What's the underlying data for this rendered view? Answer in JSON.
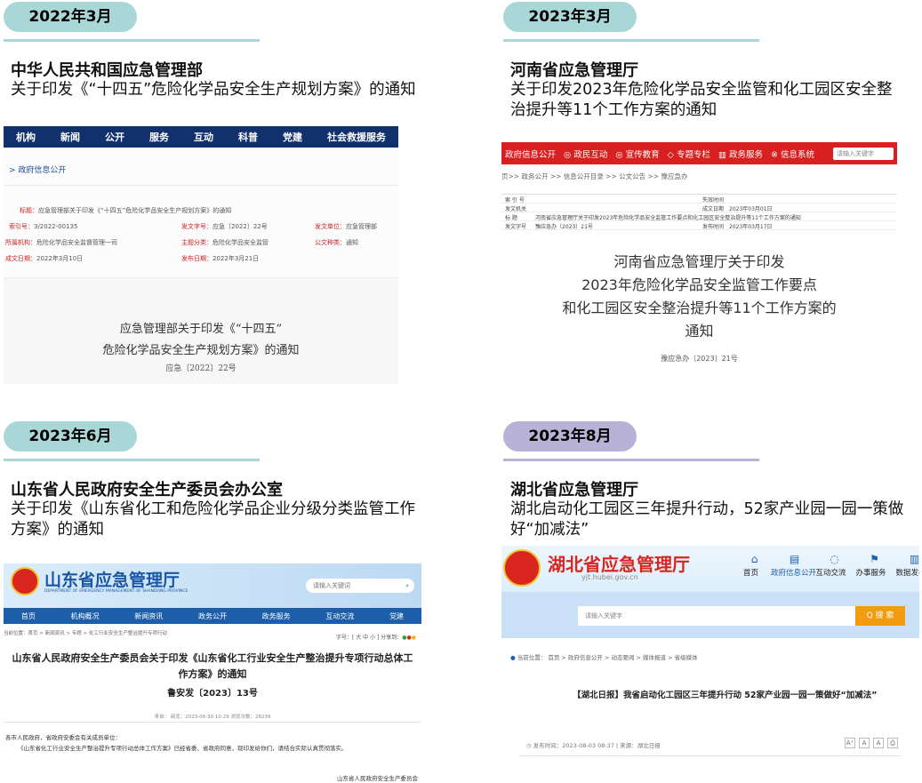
{
  "panels": [
    {
      "date": "2022年3月",
      "org": "中华人民共和国应急管理部",
      "title": "关于印发《“十四五”危险化学品安全生产规划方案》的通知"
    },
    {
      "date": "2023年3月",
      "org": "河南省应急管理厅",
      "title": "关于印发2023年危险化学品安全监管和化工园区安全整治提升等11个工作方案的通知"
    },
    {
      "date": "2023年6月",
      "org": "山东省人民政府安全生产委员会办公室",
      "title": "关于印发《山东省化工和危险化学品企业分级分类监管工作方案》的通知"
    },
    {
      "date": "2023年8月",
      "org": "湖北省应急管理厅",
      "title": "湖北启动化工园区三年提升行动，52家产业园一园一策做好“加减法”"
    }
  ],
  "colors": {
    "pill_teal": "#a9d6d7",
    "pill_purple": "#b8b2d6"
  },
  "shot1": {
    "nav": [
      "机构",
      "新闻",
      "公开",
      "服务",
      "互动",
      "科普",
      "党建",
      "社会救援服务"
    ],
    "breadcrumb": "> 政府信息公开",
    "label_title": "标题：",
    "val_title": "应急管理部关于印发《“十四五”危险化学品安全生产规划方案》的通知",
    "label_index": "索引号：",
    "val_index": "3/2022-00135",
    "label_doc_no": "发文字号：",
    "val_doc_no": "应急〔2022〕22号",
    "label_issuer": "发文单位：",
    "val_issuer": "应急管理部",
    "label_dept": "所属机构：",
    "val_dept": "危险化学品安全监督管理一司",
    "label_topic": "主题分类：",
    "val_topic": "危险化学品安全监管",
    "label_type": "公文种类：",
    "val_type": "通知",
    "label_created": "成文日期：",
    "val_created": "2022年3月10日",
    "label_published": "发布日期：",
    "val_published": "2022年3月21日",
    "doc_line1": "应急管理部关于印发《“十四五”",
    "doc_line2": "危险化学品安全生产规划方案》的通知",
    "doc_number": "应急〔2022〕22号"
  },
  "shot2": {
    "nav": [
      "政府信息公开",
      "政民互动",
      "宣传教育",
      "专题专栏",
      "政务服务",
      "信息系统"
    ],
    "search": "请输入关键字",
    "breadcrumb": "页>> 政务公开 >> 信息公开目录 >> 公文公告 >> 豫应急办",
    "row1_l": "索 引 号",
    "row1_r": "失效时间",
    "row2_l": "发文机关",
    "row2_r": "成文日期",
    "row2_v": "2023年03月01日",
    "row3_l": "标    题",
    "row3_v": "河南省应急管理厅关于印发2023年危险化学品安全监管工作要点和化工园区安全整治提升等11个工作方案的通知",
    "row4_l": "发文字号",
    "row4_v": "豫应急办〔2023〕21号",
    "row4_r": "发布时间",
    "row4_rv": "2023年03月17日",
    "doc_line1": "河南省应急管理厅关于印发",
    "doc_line2": "2023年危险化学品安全监管工作要点",
    "doc_line3": "和化工园区安全整治提升等11个工作方案的",
    "doc_line4": "通知",
    "doc_number": "豫应急办〔2023〕21号"
  },
  "shot3": {
    "site": "山东省应急管理厅",
    "site_en": "DEPARTMENT OF EMERGENCY MANAGEMENT OF SHANDONG PROVINCE",
    "search": "请输入关键词",
    "nav": [
      "首页",
      "机构概况",
      "新闻资讯",
      "政务公开",
      "政务服务",
      "互动交流",
      "党建"
    ],
    "breadcrumb": "当前位置：首页 > 新闻资讯 > 专题 > 化工行业安全生产整治提升专项行动",
    "tools": "字号：[ 大 中 小 ]  分享到：",
    "title": "山东省人民政府安全生产委员会关于印发《山东省化工行业安全生产整治提升专项行动总体工作方案》的通知",
    "code": "鲁安发〔2023〕13号",
    "info": "来自：  阅览：2023-06-30 10:29  浏览次数：28239",
    "p1": "各市人民政府，省政府安委会有关成员单位：",
    "p2": "《山东省化工行业安全生产整治提升专项行动总体工作方案》已经省委、省政府同意，现印发给你们，请结合实际认真贯彻落实。",
    "sign": "山东省人民政府安全生产委员会"
  },
  "shot4": {
    "site": "湖北省应急管理厅",
    "url": "yjt.hubei.gov.cn",
    "nav": [
      {
        "icon": "⌂",
        "label": "首页"
      },
      {
        "icon": "▤",
        "label": "政府信息公开"
      },
      {
        "icon": "◌",
        "label": "互动交流"
      },
      {
        "icon": "⚑",
        "label": "办事服务"
      },
      {
        "icon": "▥",
        "label": "数据发布"
      }
    ],
    "search": "请输入关键字",
    "search_btn": "Q 搜 索",
    "breadcrumb": "当前位置：  首页  >  政府信息公开  >  动态要闻  >  媒体报道  >  省级媒体",
    "title": "【湖北日报】我省启动化工园区三年提升行动 52家产业园一园一策做好“加减法”",
    "meta": "发布时间：2023-08-03 08:37   |   来源：湖北日报",
    "fontsizes": [
      "A⁺",
      "A",
      "A",
      "⎙"
    ]
  }
}
